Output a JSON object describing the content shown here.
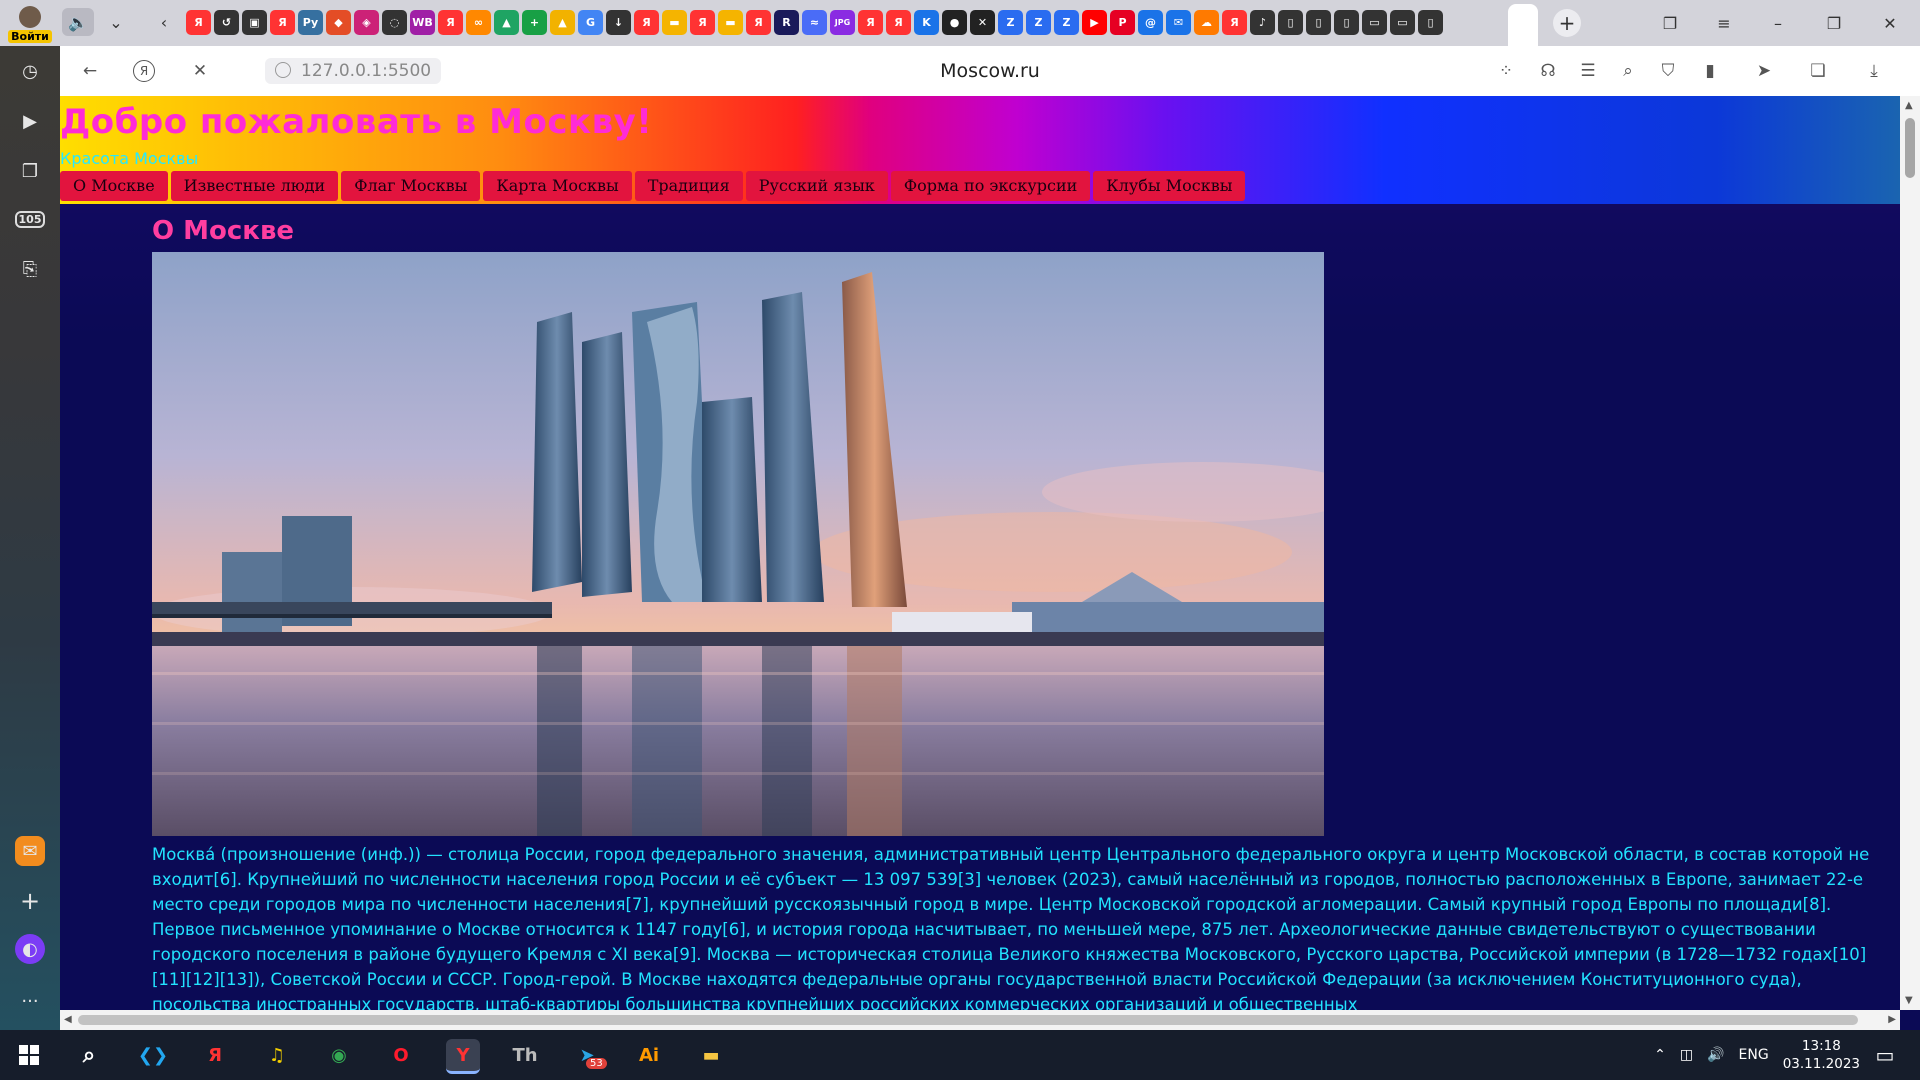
{
  "browser": {
    "login_label": "Войти",
    "url": "127.0.0.1:5500",
    "page_title": "Moscow.ru",
    "sidebar_badge": "105",
    "pinned_tabs": [
      {
        "glyph": "Я",
        "color": "#ff3333"
      },
      {
        "glyph": "↺",
        "color": "#333333"
      },
      {
        "glyph": "▣",
        "color": "#333333"
      },
      {
        "glyph": "Я",
        "color": "#ff3333"
      },
      {
        "glyph": "Py",
        "color": "#3670a0"
      },
      {
        "glyph": "◆",
        "color": "#e44d26"
      },
      {
        "glyph": "◈",
        "color": "#cc2277"
      },
      {
        "glyph": "◌",
        "color": "#333333"
      },
      {
        "glyph": "WB",
        "color": "#a01fa6"
      },
      {
        "glyph": "Я",
        "color": "#ff3333"
      },
      {
        "glyph": "∞",
        "color": "#ff8800"
      },
      {
        "glyph": "▲",
        "color": "#1fa463"
      },
      {
        "glyph": "+",
        "color": "#18a045"
      },
      {
        "glyph": "▲",
        "color": "#f2b200"
      },
      {
        "glyph": "G",
        "color": "#4285f4"
      },
      {
        "glyph": "↓",
        "color": "#333333"
      },
      {
        "glyph": "Я",
        "color": "#ff3333"
      },
      {
        "glyph": "▬",
        "color": "#f5b400"
      },
      {
        "glyph": "Я",
        "color": "#ff3333"
      },
      {
        "glyph": "▬",
        "color": "#f5b400"
      },
      {
        "glyph": "Я",
        "color": "#ff3333"
      },
      {
        "glyph": "R",
        "color": "#1a1a5a"
      },
      {
        "glyph": "≈",
        "color": "#4a6cf7"
      },
      {
        "glyph": "JPG",
        "color": "#8a2be2"
      },
      {
        "glyph": "Я",
        "color": "#ff3333"
      },
      {
        "glyph": "Я",
        "color": "#ff3333"
      },
      {
        "glyph": "K",
        "color": "#1a73e8"
      },
      {
        "glyph": "●",
        "color": "#222222"
      },
      {
        "glyph": "✕",
        "color": "#222222"
      },
      {
        "glyph": "Z",
        "color": "#2a6cf0"
      },
      {
        "glyph": "Z",
        "color": "#2a6cf0"
      },
      {
        "glyph": "Z",
        "color": "#2a6cf0"
      },
      {
        "glyph": "▶",
        "color": "#ff0000"
      },
      {
        "glyph": "P",
        "color": "#e60023"
      },
      {
        "glyph": "@",
        "color": "#1a73e8"
      },
      {
        "glyph": "✉",
        "color": "#1a73e8"
      },
      {
        "glyph": "☁",
        "color": "#ff7a00"
      },
      {
        "glyph": "Я",
        "color": "#ff3333"
      },
      {
        "glyph": "♪",
        "color": "#333333"
      },
      {
        "glyph": "▯",
        "color": "#333333"
      },
      {
        "glyph": "▯",
        "color": "#333333"
      },
      {
        "glyph": "▯",
        "color": "#333333"
      },
      {
        "glyph": "▭",
        "color": "#333333"
      },
      {
        "glyph": "▭",
        "color": "#333333"
      },
      {
        "glyph": "▯",
        "color": "#333333"
      }
    ]
  },
  "page": {
    "heading": "Добро пожаловать в Москву!",
    "subtitle": "Красота Москвы",
    "nav": [
      "О Москве",
      "Известные люди",
      "Флаг Москвы",
      "Карта Москвы",
      "Традиция",
      "Русский язык",
      "Форма по экскурсии",
      "Клубы Москвы"
    ],
    "section_title": "О Москве",
    "paragraph": "Москва́ (произношение (инф.)) — столица России, город федерального значения, административный центр Центрального федерального округа и центр Московской области, в состав которой не входит[6]. Крупнейший по численности населения город России и её субъект — 13 097 539[3] человек (2023), самый населённый из городов, полностью расположенных в Европе, занимает 22-е место среди городов мира по численности населения[7], крупнейший русскоязычный город в мире. Центр Московской городской агломерации. Самый крупный город Европы по площади[8]. Первое письменное упоминание о Москве относится к 1147 году[6], и история города насчитывает, по меньшей мере, 875 лет. Археологические данные свидетельствуют о существовании городского поселения в районе будущего Кремля с XI века[9]. Москва — историческая столица Великого княжества Московского, Русского царства, Российской империи (в 1728—1732 годах[10][11][12][13]), Советской России и СССР. Город-герой. В Москве находятся федеральные органы государственной власти Российской Федерации (за исключением Конституционного суда), посольства иностранных государств, штаб-квартиры большинства крупнейших российских коммерческих организаций и общественных"
  },
  "taskbar": {
    "lang": "ENG",
    "time": "13:18",
    "date": "03.11.2023",
    "telegram_badge": "53",
    "apps": [
      {
        "name": "vscode",
        "glyph": "❮❯",
        "color": "#22a7f0"
      },
      {
        "name": "yandex",
        "glyph": "Я",
        "color": "#ff3333"
      },
      {
        "name": "yandex-music",
        "glyph": "♫",
        "color": "#f5d000"
      },
      {
        "name": "chrome",
        "glyph": "◉",
        "color": "#34a853"
      },
      {
        "name": "opera",
        "glyph": "O",
        "color": "#ff1b2d"
      },
      {
        "name": "yandex-browser",
        "glyph": "Y",
        "color": "#ff3333"
      },
      {
        "name": "typora",
        "glyph": "Th",
        "color": "#bbbbbb"
      },
      {
        "name": "telegram",
        "glyph": "➤",
        "color": "#2aa4e3"
      },
      {
        "name": "illustrator",
        "glyph": "Ai",
        "color": "#ff9a00"
      },
      {
        "name": "explorer",
        "glyph": "▬",
        "color": "#f5c542"
      }
    ]
  }
}
